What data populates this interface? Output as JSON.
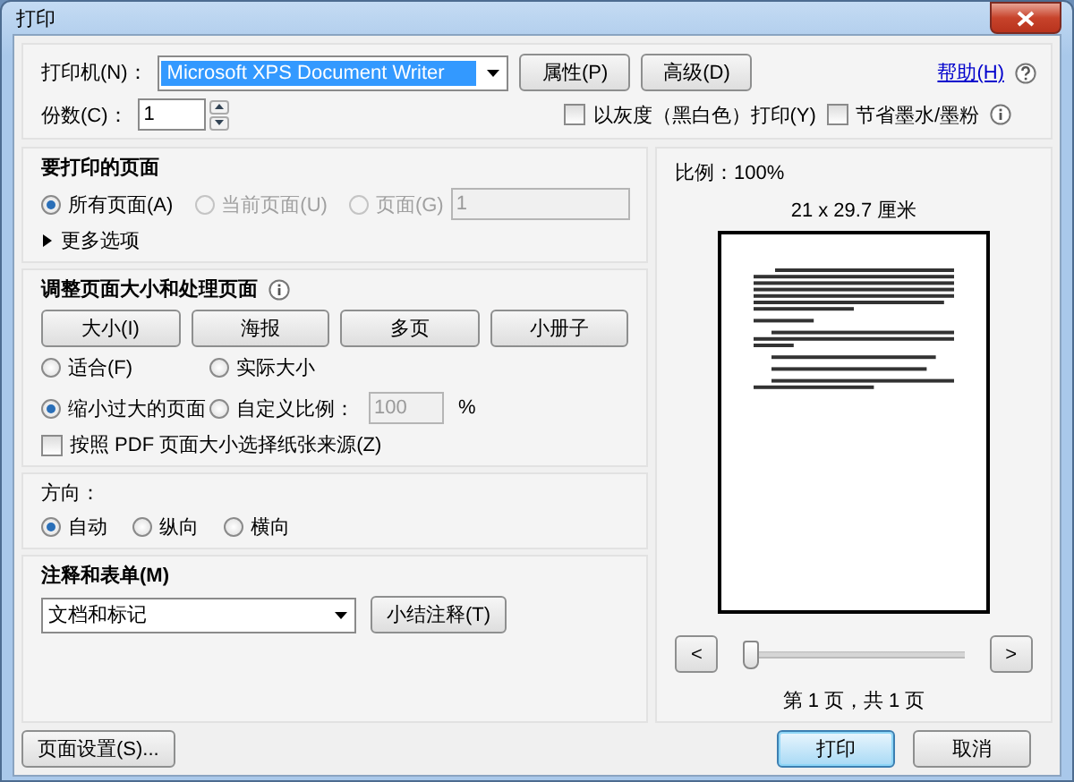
{
  "window": {
    "title": "打印"
  },
  "printer": {
    "label": "打印机(N)：",
    "value": "Microsoft XPS Document Writer",
    "buttons": [
      "属性(P)",
      "高级(D)"
    ]
  },
  "help_link": "帮助(H)",
  "copies": {
    "label": "份数(C)：",
    "value": "1"
  },
  "print_options": [
    {
      "label": "以灰度（黑白色）打印(Y)",
      "checked": false
    },
    {
      "label": "节省墨水/墨粉",
      "checked": false
    }
  ],
  "pages_section": {
    "title": "要打印的页面",
    "radios": [
      {
        "label": "所有页面(A)",
        "selected": true,
        "disabled": false
      },
      {
        "label": "当前页面(U)",
        "selected": false,
        "disabled": true
      },
      {
        "label": "页面(G)",
        "selected": false,
        "disabled": true
      }
    ],
    "pages_field": "1",
    "more_options": "更多选项",
    "more_options_expanded": false
  },
  "sizing_section": {
    "title": "调整页面大小和处理页面",
    "buttons": [
      "大小(I)",
      "海报",
      "多页",
      "小册子"
    ],
    "radios": [
      {
        "label": "适合(F)",
        "selected": false
      },
      {
        "label": "实际大小",
        "selected": false
      },
      {
        "label": "缩小过大的页面",
        "selected": true
      },
      {
        "label": "自定义比例：",
        "selected": false
      }
    ],
    "scale_field": "100",
    "percent": "%",
    "paper_source": {
      "label": "按照 PDF 页面大小选择纸张来源(Z)",
      "checked": false
    }
  },
  "orientation_section": {
    "title": "方向：",
    "radios": [
      {
        "label": "自动",
        "selected": true
      },
      {
        "label": "纵向",
        "selected": false
      },
      {
        "label": "横向",
        "selected": false
      }
    ]
  },
  "comments_section": {
    "title": "注释和表单(M)",
    "select": "文档和标记",
    "button": "小结注释(T)"
  },
  "page_setup_button": "页面设置(S)...",
  "preview": {
    "scale": "比例：100%",
    "size": "21 x 29.7 厘米",
    "prev": "<",
    "next": ">",
    "slider": {
      "level": 0
    },
    "page_label": "第 1 页，共 1 页"
  },
  "buttons": [
    {
      "label": "打印",
      "default": true
    },
    {
      "label": "取消",
      "default": false
    }
  ]
}
